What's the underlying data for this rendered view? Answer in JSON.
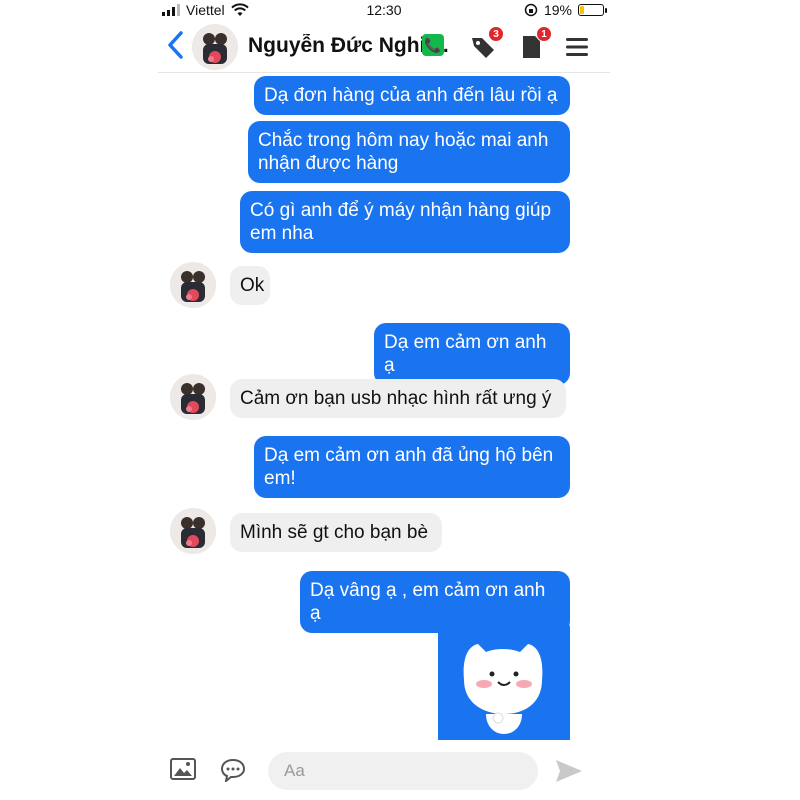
{
  "status_bar": {
    "carrier": "Viettel",
    "time": "12:30",
    "battery": "19%",
    "battery_level": 0.19
  },
  "header": {
    "contact_name": "Nguyễn Đức Nghiệ...",
    "tags_badge": "3",
    "pages_badge": "1"
  },
  "messages": [
    {
      "side": "out",
      "text": "Dạ đơn hàng của anh đến lâu rồi ạ"
    },
    {
      "side": "out",
      "text": "Chắc trong hôm nay hoặc mai anh nhận được hàng"
    },
    {
      "side": "out",
      "text": "Có gì anh để ý máy nhận hàng giúp em nha"
    },
    {
      "side": "in",
      "text": "Ok"
    },
    {
      "side": "out",
      "text": "Dạ em cảm ơn anh ạ"
    },
    {
      "side": "in",
      "text": "Cảm ơn bạn usb nhạc hình rất ưng ý"
    },
    {
      "side": "out",
      "text": "Dạ em cảm ơn anh đã ủng hộ bên em!"
    },
    {
      "side": "in",
      "text": "Mình sẽ gt cho bạn bè"
    },
    {
      "side": "out",
      "text": "Dạ vâng ạ , em cảm ơn anh ạ"
    }
  ],
  "composer": {
    "placeholder": "Aa"
  },
  "colors": {
    "outgoing_bubble": "#1a74f0",
    "incoming_bubble": "#efefef",
    "accent": "#1a74f0"
  }
}
